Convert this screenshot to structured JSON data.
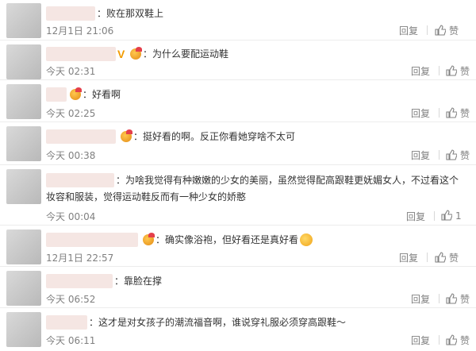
{
  "comments": [
    {
      "text": "：败在那双鞋上",
      "time": "12月1日 21:06",
      "reply": "回复",
      "like": "赞"
    },
    {
      "text": "：为什么要配运动鞋",
      "time": "今天 02:31",
      "reply": "回复",
      "like": "赞"
    },
    {
      "text": "：好看啊",
      "time": "今天 02:25",
      "reply": "回复",
      "like": "赞"
    },
    {
      "text": "：挺好看的啊。反正你看她穿啥不太可",
      "time": "今天 00:38",
      "reply": "回复",
      "like": "赞"
    },
    {
      "text_line1": "：为啥我觉得有种嫩嫩的少女的美丽，虽然觉得配高跟鞋更妩媚女人，不过看这个",
      "text_line2": "妆容和服装，觉得运动鞋反而有一种少女的娇憨",
      "time": "今天 00:04",
      "reply": "回复",
      "like": "1"
    },
    {
      "text": "：确实像浴袍，但好看还是真好看",
      "time": "12月1日 22:57",
      "reply": "回复",
      "like": "赞"
    },
    {
      "text": "：靠脸在撑",
      "time": "今天 06:52",
      "reply": "回复",
      "like": "赞"
    },
    {
      "text": "：这才是对女孩子的潮流福音啊，谁说穿礼服必须穿高跟鞋～",
      "time": "今天 06:11",
      "reply": "回复",
      "like": "赞"
    }
  ]
}
